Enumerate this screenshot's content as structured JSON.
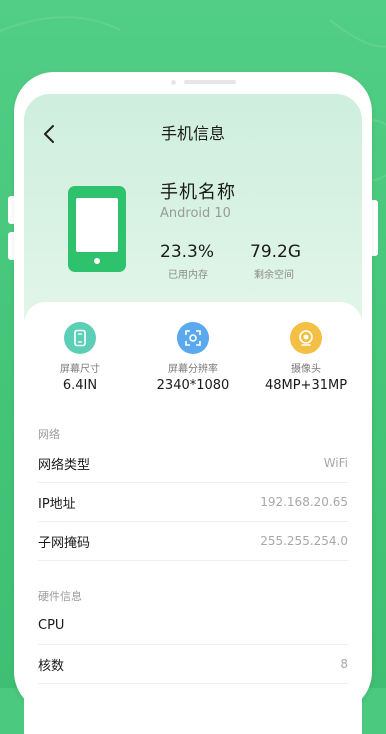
{
  "header": {
    "title": "手机信息",
    "device_name": "手机名称",
    "os_version": "Android 10",
    "memory_used_value": "23.3%",
    "memory_used_label": "已用内存",
    "storage_free_value": "79.2G",
    "storage_free_label": "剩余空间"
  },
  "features": [
    {
      "label": "屏幕尺寸",
      "value": "6.4IN",
      "icon": "screen-size-icon",
      "color": "#5ccfb6"
    },
    {
      "label": "屏幕分辨率",
      "value": "2340*1080",
      "icon": "resolution-icon",
      "color": "#5aa8ee"
    },
    {
      "label": "摄像头",
      "value": "48MP+31MP",
      "icon": "camera-icon",
      "color": "#f3bf45"
    }
  ],
  "network": {
    "section_title": "网络",
    "rows": [
      {
        "label": "网络类型",
        "value": "WiFi"
      },
      {
        "label": "IP地址",
        "value": "192.168.20.65"
      },
      {
        "label": "子网掩码",
        "value": "255.255.254.0"
      }
    ]
  },
  "hardware": {
    "section_title": "硬件信息",
    "rows": [
      {
        "label": "CPU",
        "value": ""
      },
      {
        "label": "核数",
        "value": "8"
      }
    ]
  },
  "colors": {
    "accent_green": "#2fc26c",
    "background": "#4bc97e"
  }
}
